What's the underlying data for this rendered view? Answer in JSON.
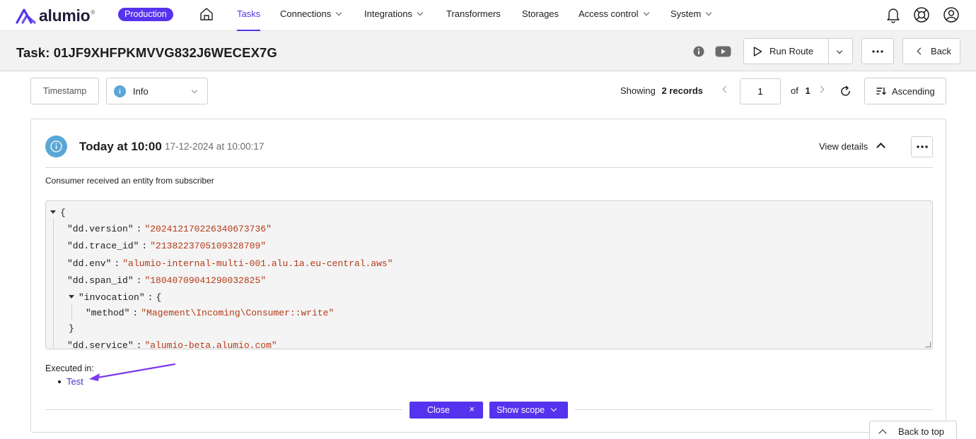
{
  "nav": {
    "logo_text": "alumio",
    "logo_mark": "®",
    "environment": "Production",
    "items": [
      {
        "label": "Tasks",
        "active": true
      },
      {
        "label": "Connections",
        "dropdown": true
      },
      {
        "label": "Integrations",
        "dropdown": true
      },
      {
        "label": "Transformers"
      },
      {
        "label": "Storages"
      },
      {
        "label": "Access control",
        "dropdown": true
      },
      {
        "label": "System",
        "dropdown": true
      }
    ],
    "accent_color": "#5533ee"
  },
  "header": {
    "title": "Task: 01JF9XHFPKMVVG832J6WECEX7G",
    "run_label": "Run Route",
    "back_label": "Back"
  },
  "filters": {
    "timestamp_label": "Timestamp",
    "level_value": "Info",
    "showing_label": "Showing",
    "records_count": "2 records",
    "page_value": "1",
    "of_label": "of",
    "total_pages": "1",
    "sort_label": "Ascending"
  },
  "record": {
    "time_label": "Today at 10:00",
    "timestamp": "17-12-2024 at 10:00:17",
    "view_details_label": "View details",
    "message": "Consumer received an entity from subscriber",
    "json_lines": {
      "open": "{",
      "version_key": "\"dd.version\"",
      "version_val": "\"202412170226340673736\"",
      "trace_key": "\"dd.trace_id\"",
      "trace_val": "\"2138223705109328709\"",
      "env_key": "\"dd.env\"",
      "env_val": "\"alumio-internal-multi-001.alu.1a.eu-central.aws\"",
      "span_key": "\"dd.span_id\"",
      "span_val": "\"18040709041290032825\"",
      "invocation_key": "\"invocation\"",
      "invocation_open": "{",
      "method_key": "\"method\"",
      "method_val": "\"Magement\\Incoming\\Consumer::write\"",
      "invocation_close": "}",
      "service_key": "\"dd.service\"",
      "service_val": "\"alumio-beta.alumio.com\"",
      "colon": ":"
    },
    "executed_in_label": "Executed in:",
    "executed_in": [
      "Test"
    ],
    "close_label": "Close",
    "close_x": "×",
    "show_scope_label": "Show scope"
  },
  "back_to_top_label": "Back to top"
}
